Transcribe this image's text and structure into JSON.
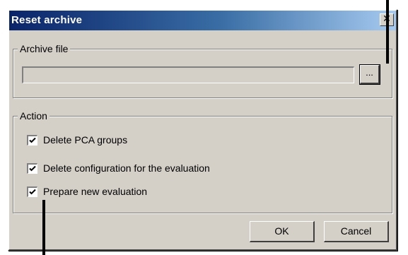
{
  "window": {
    "title": "Reset archive",
    "close_glyph": "✕"
  },
  "archive_group": {
    "legend": "Archive file",
    "path_value": "",
    "browse_label": "..."
  },
  "action_group": {
    "legend": "Action",
    "options": [
      {
        "label": "Delete PCA groups",
        "checked": true
      },
      {
        "label": "Delete configuration for the evaluation",
        "checked": true
      },
      {
        "label": "Prepare new evaluation",
        "checked": true
      }
    ]
  },
  "buttons": {
    "ok": "OK",
    "cancel": "Cancel"
  },
  "colors": {
    "dialog_face": "#d4d0c8",
    "titlebar_start": "#0a246a",
    "titlebar_end": "#a6caf0",
    "title_text": "#ffffff",
    "pointer_marker": "#000000"
  },
  "icons": {
    "close": "close-icon",
    "check": "checkmark-icon"
  }
}
